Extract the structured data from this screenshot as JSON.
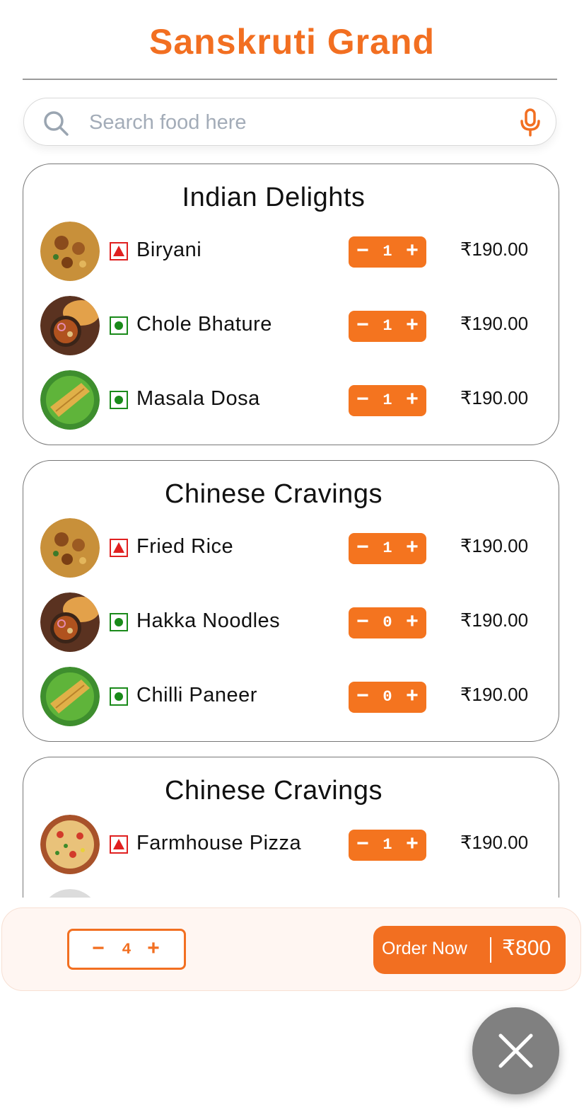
{
  "header": {
    "title": "Sanskruti Grand"
  },
  "search": {
    "placeholder": "Search food here"
  },
  "sections": [
    {
      "title": "Indian Delights",
      "items": [
        {
          "name": "Biryani",
          "diet": "non-veg",
          "image": "biryani",
          "qty": "1",
          "price": "₹190.00"
        },
        {
          "name": "Chole Bhature",
          "diet": "veg",
          "image": "chole-bhature",
          "qty": "1",
          "price": "₹190.00"
        },
        {
          "name": "Masala Dosa",
          "diet": "veg",
          "image": "masala-dosa",
          "qty": "1",
          "price": "₹190.00"
        }
      ]
    },
    {
      "title": "Chinese Cravings",
      "items": [
        {
          "name": "Fried Rice",
          "diet": "non-veg",
          "image": "biryani",
          "qty": "1",
          "price": "₹190.00"
        },
        {
          "name": "Hakka Noodles",
          "diet": "veg",
          "image": "chole-bhature",
          "qty": "0",
          "price": "₹190.00"
        },
        {
          "name": "Chilli Paneer",
          "diet": "veg",
          "image": "masala-dosa",
          "qty": "0",
          "price": "₹190.00"
        }
      ]
    },
    {
      "title": "Chinese Cravings",
      "items": [
        {
          "name": "Farmhouse Pizza",
          "diet": "non-veg",
          "image": "pizza",
          "qty": "1",
          "price": "₹190.00"
        }
      ]
    }
  ],
  "stepper": {
    "minus": "−",
    "plus": "+"
  },
  "cart": {
    "qty": "4",
    "order_label": "Order Now",
    "total": "₹800"
  },
  "icons": {
    "search": "search-icon",
    "mic": "mic-icon",
    "close": "close-icon"
  },
  "colors": {
    "accent": "#f26f21",
    "veg": "#1a8a1a",
    "non_veg": "#e02020",
    "fab": "#808080"
  }
}
